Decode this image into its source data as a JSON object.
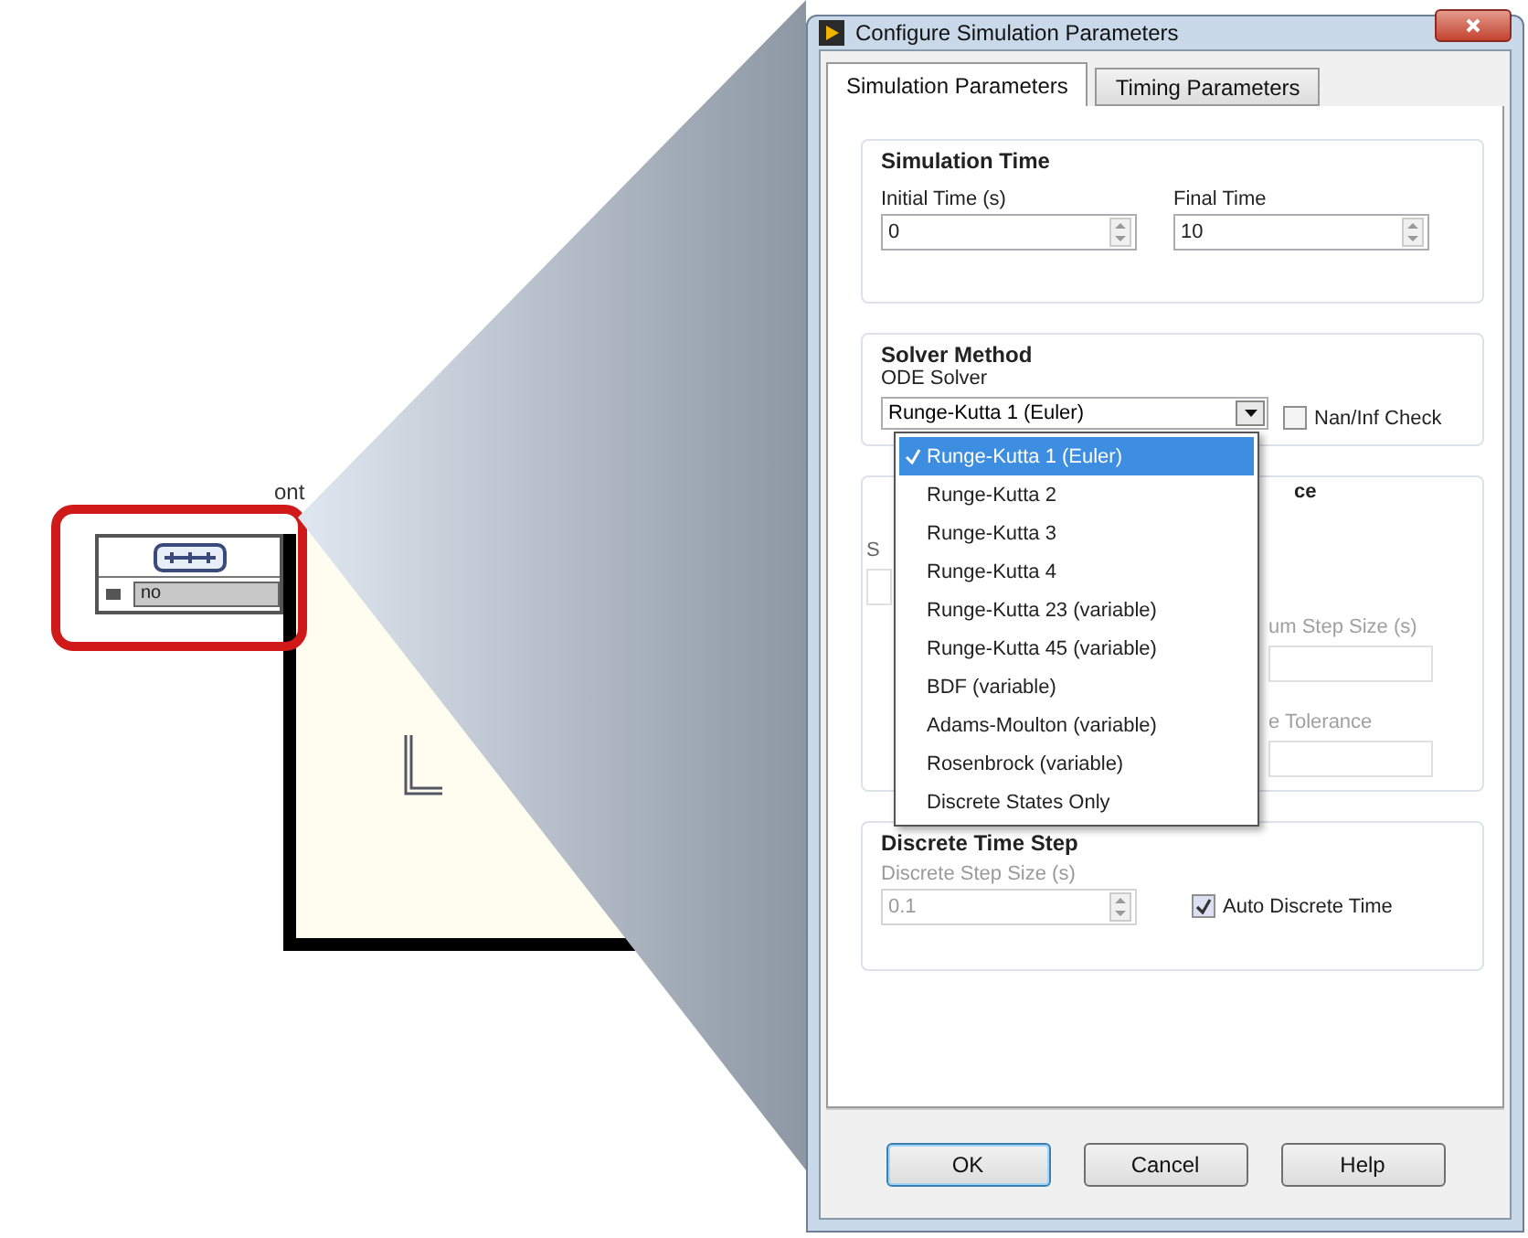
{
  "diagram": {
    "node_label": "ont",
    "node_value": "no"
  },
  "window": {
    "title": "Configure Simulation Parameters"
  },
  "tabs": [
    {
      "label": "Simulation Parameters",
      "selected": true
    },
    {
      "label": "Timing Parameters",
      "selected": false
    }
  ],
  "simulation_time": {
    "title": "Simulation Time",
    "fields": [
      {
        "label": "Initial Time (s)",
        "value": "0",
        "disabled": false
      },
      {
        "label": "Final Time",
        "value": "10",
        "disabled": false
      }
    ]
  },
  "solver_method": {
    "title": "Solver Method",
    "ode_solver": {
      "label": "ODE Solver",
      "value": "Runge-Kutta 1 (Euler)"
    },
    "nan_inf_check": {
      "label": "Nan/Inf Check",
      "checked": false
    }
  },
  "dropdown_menu": {
    "items": [
      {
        "label": "Runge-Kutta 1 (Euler)",
        "selected": true
      },
      {
        "label": "Runge-Kutta 2",
        "selected": false
      },
      {
        "label": "Runge-Kutta 3",
        "selected": false
      },
      {
        "label": "Runge-Kutta 4",
        "selected": false
      },
      {
        "label": "Runge-Kutta 23 (variable)",
        "selected": false
      },
      {
        "label": "Runge-Kutta 45 (variable)",
        "selected": false
      },
      {
        "label": "BDF (variable)",
        "selected": false
      },
      {
        "label": "Adams-Moulton (variable)",
        "selected": false
      },
      {
        "label": "Rosenbrock (variable)",
        "selected": false
      },
      {
        "label": "Discrete States Only",
        "selected": false
      }
    ]
  },
  "covered_group": {
    "title": "ce",
    "left_label": "S",
    "step_label": "um Step Size (s)",
    "tolerance_label": "e Tolerance"
  },
  "discrete_time_step": {
    "title": "Discrete Time Step",
    "step_size": {
      "label": "Discrete Step Size (s)",
      "value": "0.1",
      "disabled": true
    },
    "auto_discrete_time": {
      "label": "Auto Discrete Time",
      "checked": true
    }
  },
  "buttons": [
    {
      "label": "OK",
      "default": true
    },
    {
      "label": "Cancel",
      "default": false
    },
    {
      "label": "Help",
      "default": false
    }
  ]
}
